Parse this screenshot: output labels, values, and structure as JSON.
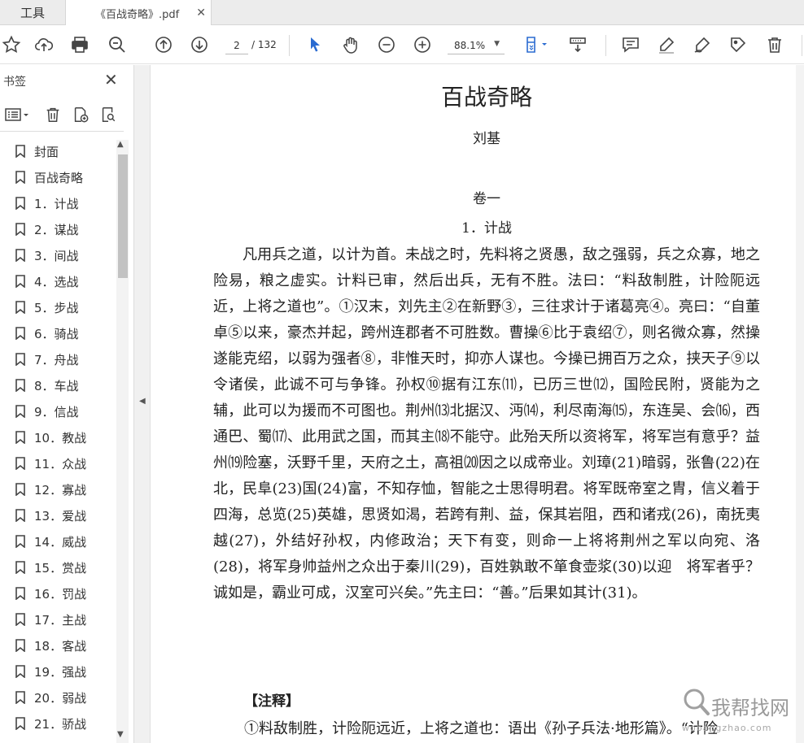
{
  "tabs": {
    "tools": "工具",
    "document": "《百战奇略》.pdf"
  },
  "toolbar": {
    "page_current": "2",
    "page_total": "/ 132",
    "zoom": "88.1%"
  },
  "sidebar": {
    "title": "书签",
    "bookmarks": [
      "封面",
      "百战奇略",
      "1．计战",
      "2．谋战",
      "3．间战",
      "4．选战",
      "5．步战",
      "6．骑战",
      "7．舟战",
      "8．车战",
      "9．信战",
      "10．教战",
      "11．众战",
      "12．寡战",
      "13．爱战",
      "14．威战",
      "15．赏战",
      "16．罚战",
      "17．主战",
      "18．客战",
      "19．强战",
      "20．弱战",
      "21．骄战"
    ]
  },
  "doc": {
    "title": "百战奇略",
    "author": "刘基",
    "volume": "卷一",
    "chapter": "1．计战",
    "body": "凡用兵之道，以计为首。未战之时，先料将之贤愚，敌之强弱，兵之众寡，地之险易，粮之虚实。计料已审，然后出兵，无有不胜。法曰：“料敌制胜，计险阨远近，上将之道也”。①汉末，刘先主②在新野③，三往求计于诸葛亮④。亮曰：“自董卓⑤以来，豪杰并起，跨州连郡者不可胜数。曹操⑥比于袁绍⑦，则名微众寡，然操遂能克绍，以弱为强者⑧，非惟天时，抑亦人谋也。今操已拥百万之众，挟天子⑨以令诸侯，此诚不可与争锋。孙权⑩据有江东⑾，已历三世⑿，国险民附，贤能为之辅，此可以为援而不可图也。荆州⒀北据汉、沔⒁，利尽南海⒂，东连吴、会⒃，西通巴、蜀⒄、此用武之国，而其主⒅不能守。此殆天所以资将军，将军岂有意乎？益州⒆险塞，沃野千里，天府之土，高祖⒇因之以成帝业。刘璋(21)暗弱，张鲁(22)在北，民阜(23)国(24)富，不知存恤，智能之士思得明君。将军既帝室之胄，信义着于四海，总览(25)英雄，思贤如渴，若跨有荆、益，保其岩阻，西和诸戎(26)，南抚夷越(27)，外结好孙权，内修政治；天下有变，则命一上将将荆州之军以向宛、洛(28)，将军身帅益州之众出于秦川(29)，百姓孰敢不箪食壶浆(30)以迎　将军者乎？诚如是，霸业可成，汉室可兴矣。”先主曰：“善。”后果如其计(31)。",
    "notes_heading": "【注释】",
    "note_1": "①料敌制胜，计险阨远近，上将之道也：语出《孙子兵法·地形篇》。“计险"
  },
  "watermark": {
    "text": "我帮找网",
    "url": "wobangzhao.com"
  }
}
